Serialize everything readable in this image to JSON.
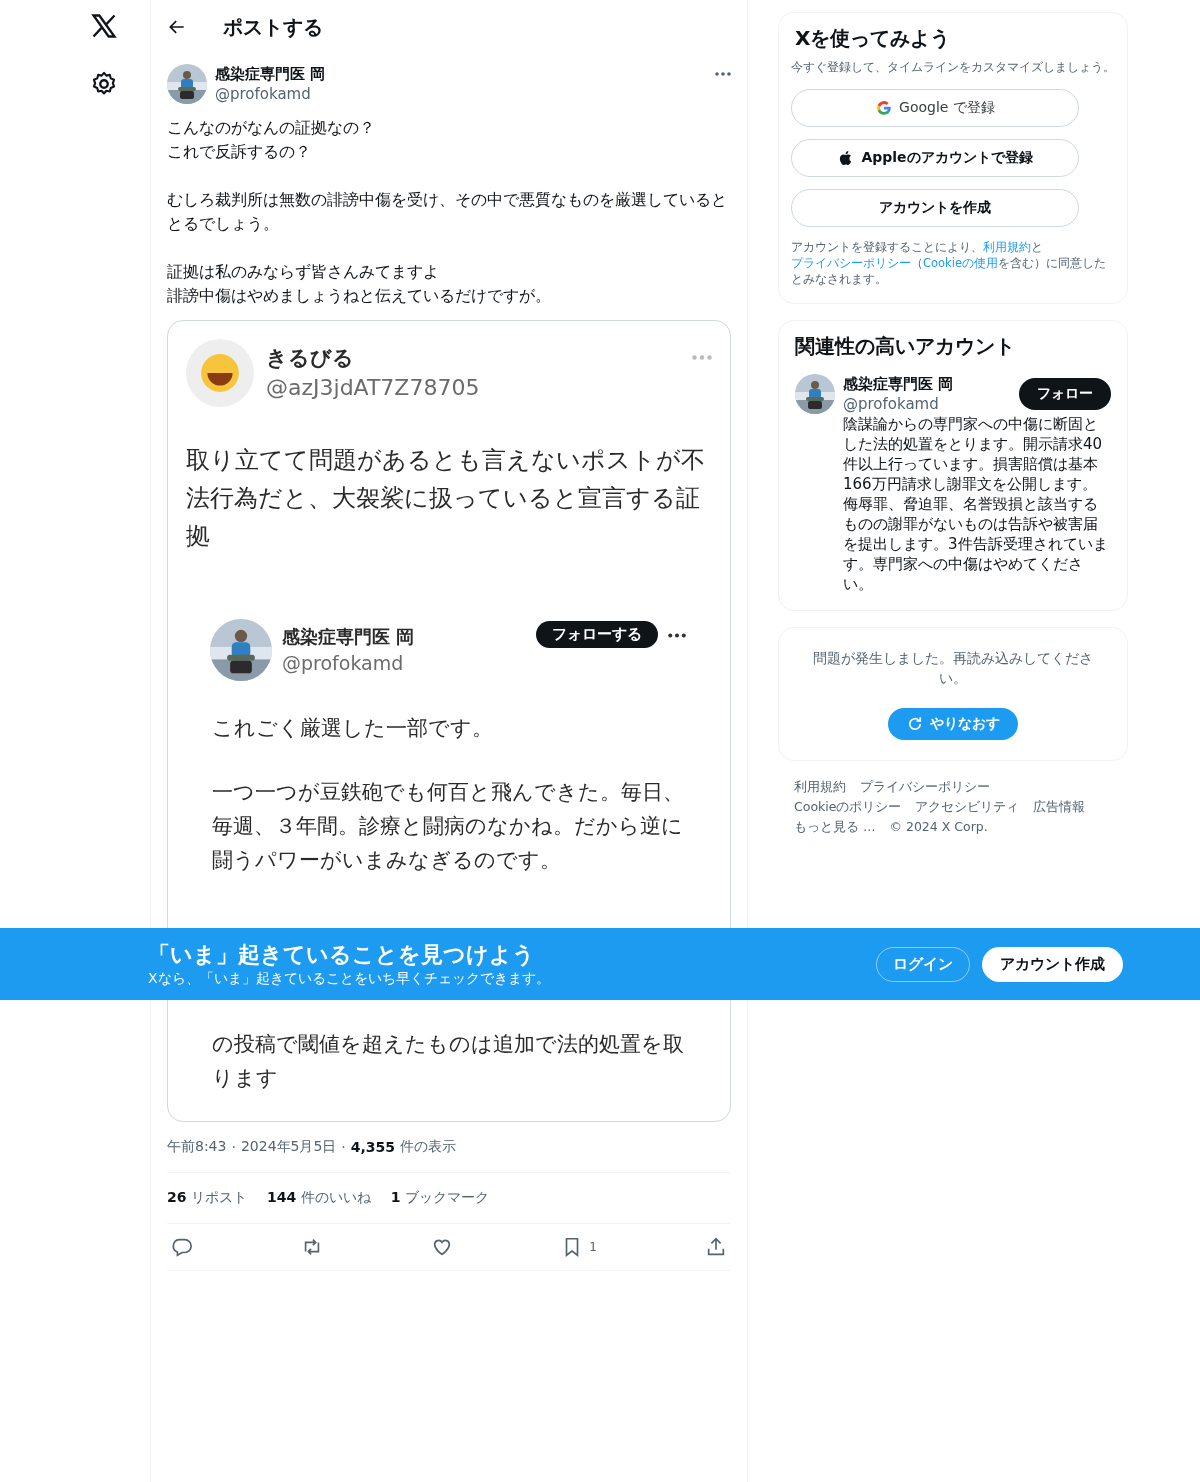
{
  "header": {
    "title": "ポストする"
  },
  "post": {
    "author": {
      "name": "感染症専門医 岡",
      "handle": "@profokamd"
    },
    "paragraphs": [
      [
        "こんなのがなんの証拠なの？",
        "これで反訴するの？"
      ],
      [
        "むしろ裁判所は無数の誹謗中傷を受け、その中で悪質なものを厳選しているととるでしょう。"
      ],
      [
        "証拠は私のみならず皆さんみてますよ",
        "誹謗中傷はやめましょうねと伝えているだけですが。"
      ]
    ],
    "embed": {
      "name": "きるびる",
      "handle": "@azJ3jdAT7Z78705",
      "text": "取り立てて問題があるとも言えないポストが不法行為だと、大袈裟に扱っていると宣言する証拠",
      "quoted": {
        "name": "感染症専門医 岡",
        "handle": "@profokamd",
        "follow": "フォローする",
        "paragraphs": [
          "これごく厳選した一部です。",
          "一つ一つが豆鉄砲でも何百と飛んできた。毎日、毎週、３年間。診療と闘病のなかね。だから逆に闘うパワーがいまみなぎるのです。"
        ],
        "after_banner": "の投稿で閾値を超えたものは追加で法的処置を取ります"
      }
    },
    "meta": [
      {
        "kind": "text",
        "text": "午前8:43"
      },
      {
        "kind": "sep",
        "text": "·"
      },
      {
        "kind": "text",
        "text": "2024年5月5日"
      },
      {
        "kind": "sep",
        "text": "·"
      },
      {
        "kind": "count",
        "text": "4,355"
      },
      {
        "kind": "text",
        "text": "件の表示"
      }
    ],
    "stats": [
      {
        "count": "26",
        "label": "リポスト"
      },
      {
        "count": "144",
        "label": "件のいいね"
      },
      {
        "count": "1",
        "label": "ブックマーク"
      }
    ],
    "actions": [
      {
        "kind": "reply"
      },
      {
        "kind": "repost"
      },
      {
        "kind": "like"
      },
      {
        "kind": "bookmark",
        "count": "1"
      },
      {
        "kind": "share"
      }
    ]
  },
  "signup": {
    "title": "Xを使ってみよう",
    "subtitle": "今すぐ登録して、タイムラインをカスタマイズしましょう。",
    "buttons": [
      {
        "kind": "google",
        "label": "Google で登録"
      },
      {
        "kind": "apple",
        "label": "Appleのアカウントで登録"
      },
      {
        "kind": "plain",
        "label": "アカウントを作成"
      }
    ],
    "legal": [
      {
        "text": "アカウントを登録することにより、",
        "link": false
      },
      {
        "text": "利用規約",
        "link": true
      },
      {
        "text": "と",
        "link": false
      },
      {
        "text": "プライバシーポリシー",
        "link": true
      },
      {
        "text": "（",
        "link": false
      },
      {
        "text": "Cookieの使用",
        "link": true
      },
      {
        "text": "を含む）に同意したとみなされます。",
        "link": false
      }
    ]
  },
  "related": {
    "title": "関連性の高いアカウント",
    "accounts": [
      {
        "name": "感染症専門医 岡",
        "handle": "@profokamd",
        "follow": "フォロー",
        "bio": "陰謀論からの専門家への中傷に断固とした法的処置をとります。開示請求40件以上行っています。損害賠償は基本166万円請求し謝罪文を公開します。侮辱罪、脅迫罪、名誉毀損と該当するものの謝罪がないものは告訴や被害届を提出します。3件告訴受理されています。専門家への中傷はやめてください。"
      }
    ]
  },
  "error": {
    "message": "問題が発生しました。再読み込みしてください。",
    "retry": "やりなおす"
  },
  "footer": [
    [
      "利用規約",
      "プライバシーポリシー"
    ],
    [
      "Cookieのポリシー",
      "アクセシビリティ",
      "広告情報"
    ],
    [
      "もっと見る …",
      "© 2024 X Corp."
    ]
  ],
  "banner": {
    "title": "「いま」起きていることを見つけよう",
    "subtitle": "Xなら、「いま」起きていることをいち早くチェックできます。",
    "login": "ログイン",
    "signup": "アカウント作成"
  }
}
